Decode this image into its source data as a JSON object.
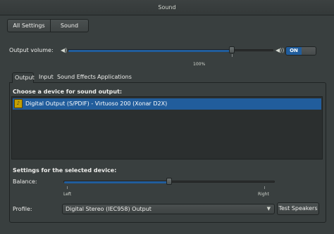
{
  "window": {
    "title": "Sound"
  },
  "nav": {
    "all_settings": "All Settings",
    "current": "Sound"
  },
  "output_volume": {
    "label": "Output volume:",
    "value_label": "100%",
    "level_percent": 80,
    "switch_on": "ON"
  },
  "tabs": [
    {
      "label": "Output"
    },
    {
      "label": "Input"
    },
    {
      "label": "Sound Effects"
    },
    {
      "label": "Applications"
    }
  ],
  "output": {
    "choose_heading": "Choose a device for sound output:",
    "devices": [
      {
        "name": "Digital Output (S/PDIF) - Virtuoso 200 (Xonar D2X)"
      }
    ],
    "settings_heading": "Settings for the selected device:",
    "balance": {
      "label": "Balance:",
      "left": "Left",
      "right": "Right",
      "level_percent": 50
    },
    "profile": {
      "label": "Profile:",
      "value": "Digital Stereo (IEC958) Output"
    },
    "test_button": "Test Speakers"
  },
  "colors": {
    "accent": "#215d9c",
    "background": "#393f3f"
  }
}
